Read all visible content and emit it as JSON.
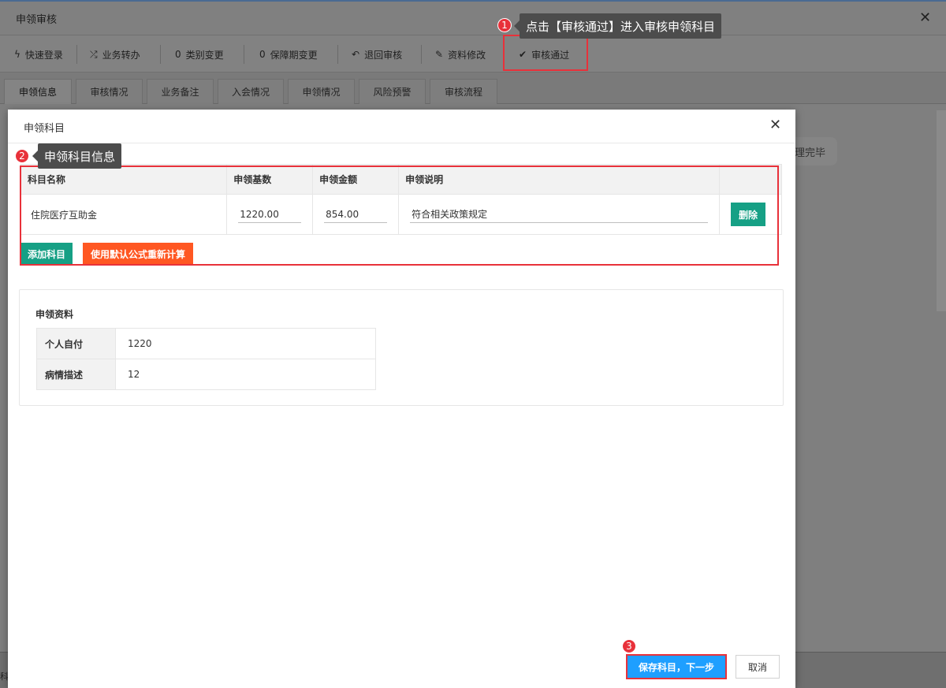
{
  "window": {
    "title": "申领审核",
    "close_glyph": "✕"
  },
  "toolbar": {
    "buttons": [
      {
        "label": "快速登录",
        "icon": "bolt-icon",
        "glyph": "ϟ"
      },
      {
        "label": "业务转办",
        "icon": "shuffle-icon",
        "glyph": "⤮"
      },
      {
        "label": "类别变更",
        "icon": "circle-o-icon",
        "glyph": "0"
      },
      {
        "label": "保障期变更",
        "icon": "circle-o-icon",
        "glyph": "0"
      },
      {
        "label": "退回审核",
        "icon": "reply-icon",
        "glyph": "↶"
      },
      {
        "label": "资料修改",
        "icon": "edit-icon",
        "glyph": "✎"
      },
      {
        "label": "审核通过",
        "icon": "check-circle-icon",
        "glyph": "✔"
      }
    ]
  },
  "tabs": [
    {
      "label": "申领信息",
      "active": true
    },
    {
      "label": "审核情况",
      "active": false
    },
    {
      "label": "业务备注",
      "active": false
    },
    {
      "label": "入会情况",
      "active": false
    },
    {
      "label": "申领情况",
      "active": false
    },
    {
      "label": "风险预警",
      "active": false
    },
    {
      "label": "审核流程",
      "active": false
    }
  ],
  "background": {
    "pill_text": "理完毕",
    "bottom_text": "科"
  },
  "modal": {
    "title": "申领科目",
    "close_glyph": "✕",
    "table": {
      "headers": [
        "科目名称",
        "申领基数",
        "申领金额",
        "申领说明",
        ""
      ],
      "rows": [
        {
          "name": "住院医疗互助金",
          "base": "1220.00",
          "amount": "854.00",
          "desc": "符合相关政策规定",
          "delete_label": "删除"
        }
      ]
    },
    "add_button": "添加科目",
    "recalc_button": "使用默认公式重新计算",
    "info": {
      "title": "申领资料",
      "rows": [
        {
          "key": "个人自付",
          "value": "1220"
        },
        {
          "key": "病情描述",
          "value": "12"
        }
      ]
    },
    "save_button": "保存科目，下一步",
    "cancel_button": "取消"
  },
  "annotations": [
    {
      "number": "1",
      "text": "点击【审核通过】进入审核申领科目"
    },
    {
      "number": "2",
      "text": "申领科目信息"
    },
    {
      "number": "3",
      "text": ""
    }
  ],
  "colors": {
    "highlight_red": "#e8313a",
    "green": "#16a085",
    "orange": "#ff5722",
    "blue": "#1e9fff"
  }
}
